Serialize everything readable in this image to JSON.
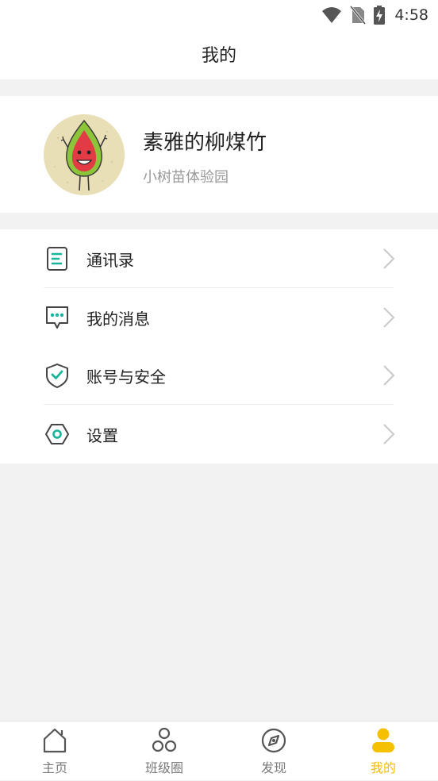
{
  "status_bar": {
    "time": "4:58"
  },
  "header": {
    "title": "我的"
  },
  "profile": {
    "name": "素雅的柳煤竹",
    "school": "小树苗体验园"
  },
  "menu": [
    {
      "label": "通讯录",
      "icon": "contacts-icon"
    },
    {
      "label": "我的消息",
      "icon": "message-icon"
    },
    {
      "label": "账号与安全",
      "icon": "shield-icon"
    },
    {
      "label": "设置",
      "icon": "settings-icon"
    }
  ],
  "tabs": [
    {
      "label": "主页",
      "icon": "home-icon"
    },
    {
      "label": "班级圈",
      "icon": "circles-icon"
    },
    {
      "label": "发现",
      "icon": "compass-icon"
    },
    {
      "label": "我的",
      "icon": "person-icon",
      "active": true
    }
  ],
  "colors": {
    "accent": "#f5c000",
    "icon_teal": "#17b59a",
    "background": "#f2f2f2"
  }
}
